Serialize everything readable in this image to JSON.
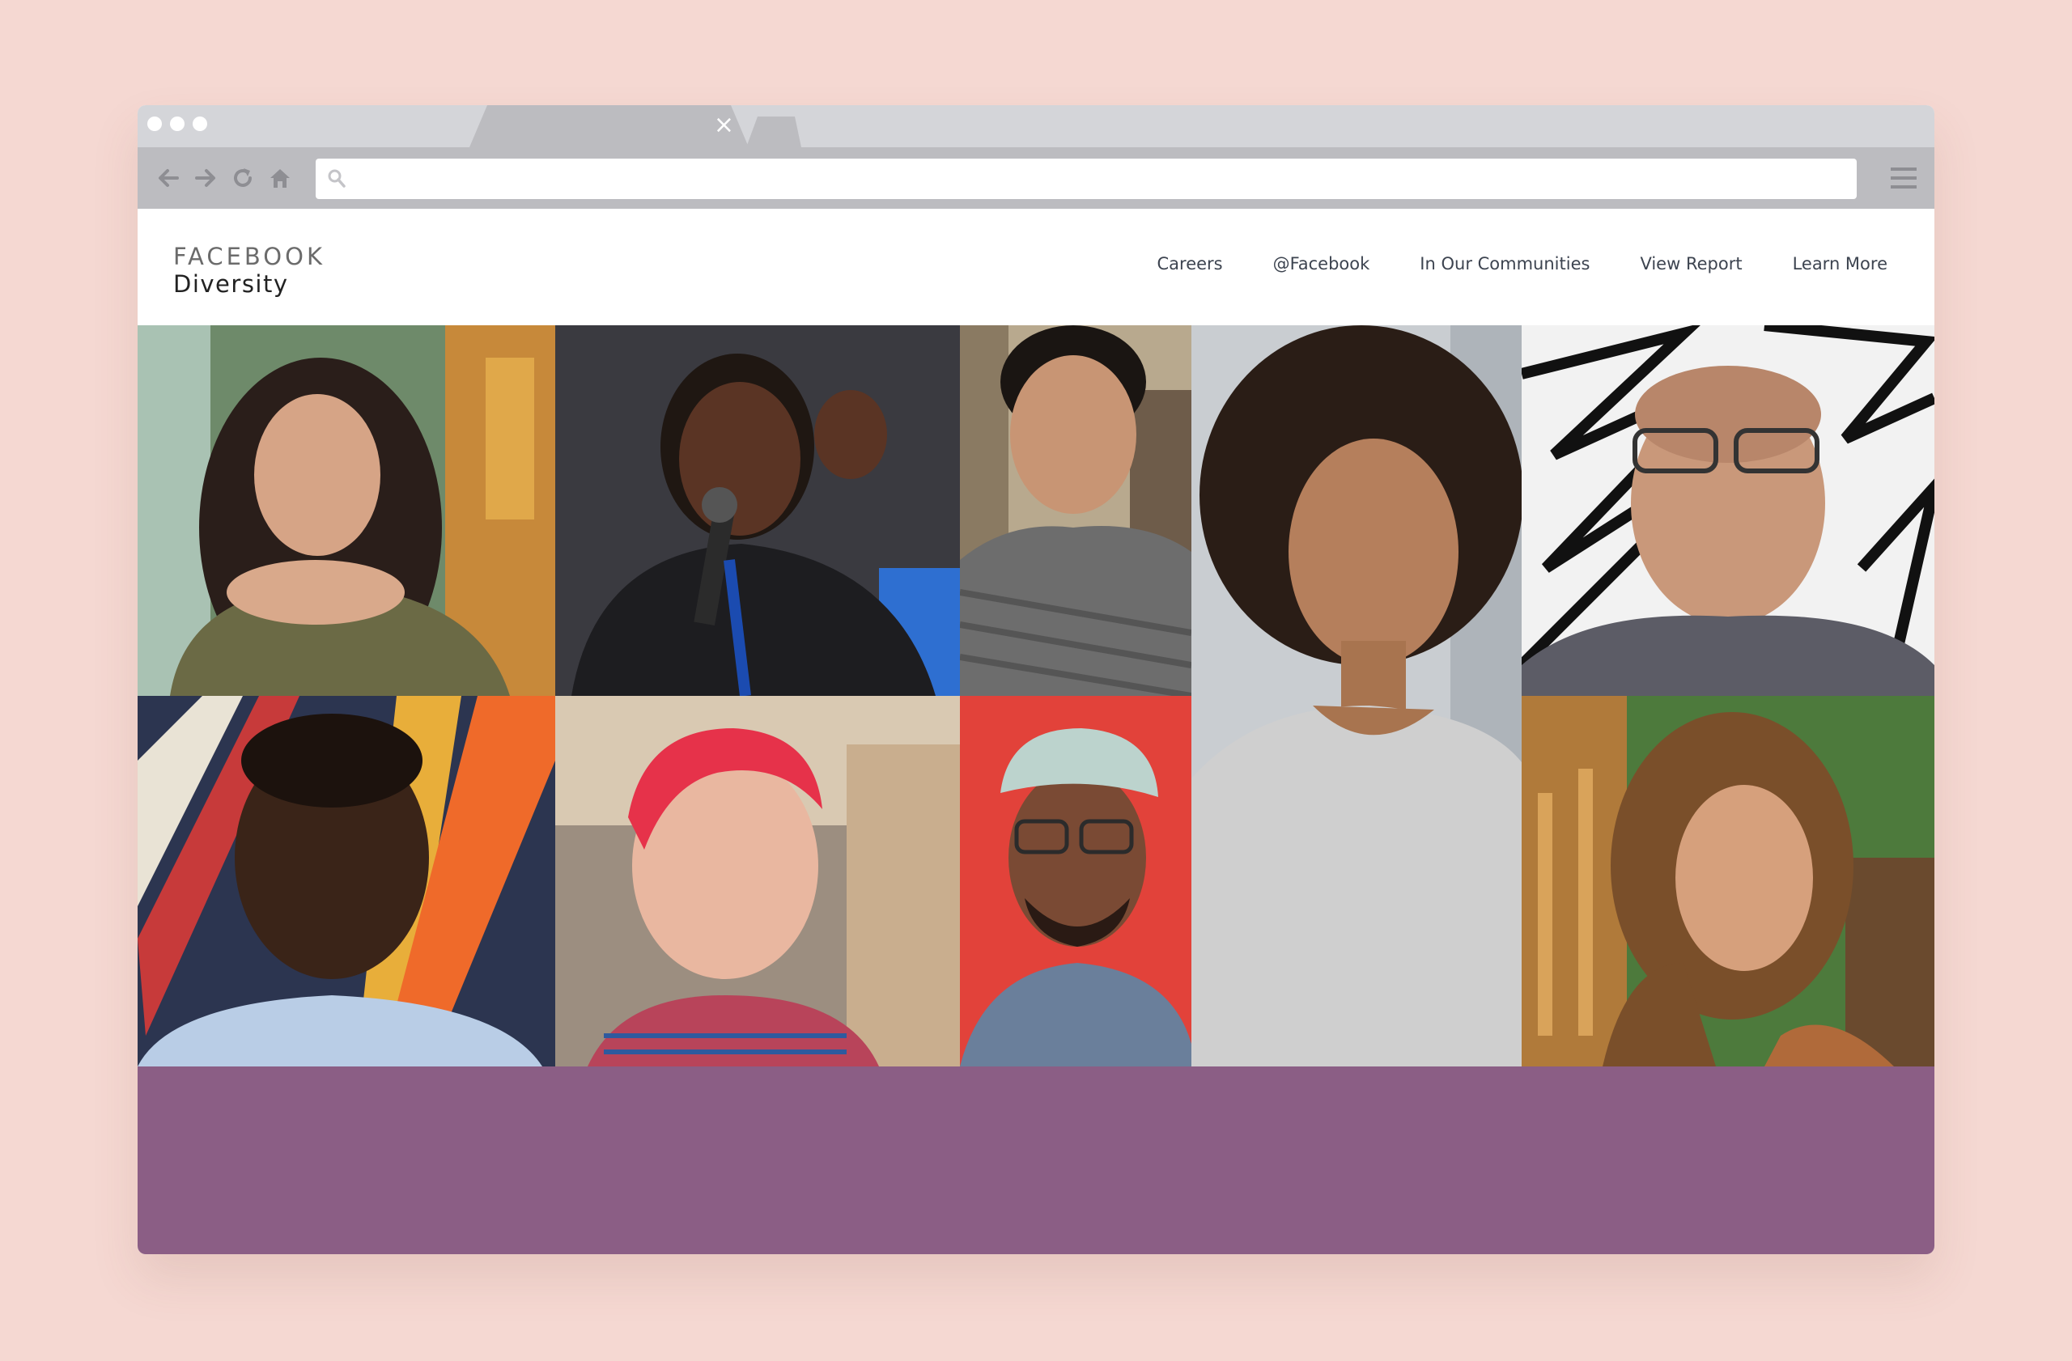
{
  "browser": {
    "tab": {
      "close_glyph": "×"
    },
    "toolbar": {
      "back_icon": "arrow-left-icon",
      "forward_icon": "arrow-right-icon",
      "reload_icon": "reload-icon",
      "home_icon": "home-icon",
      "menu_icon": "hamburger-menu-icon"
    },
    "url": {
      "value": "",
      "placeholder": ""
    }
  },
  "site": {
    "logo": {
      "line1": "FACEBOOK",
      "line2": "Diversity"
    },
    "nav": [
      {
        "label": "Careers"
      },
      {
        "label": "@Facebook"
      },
      {
        "label": "In Our Communities"
      },
      {
        "label": "View Report"
      },
      {
        "label": "Learn More"
      }
    ]
  },
  "colors": {
    "page_background": "#f5d8d2",
    "footer_band": "#8b5e85",
    "tab_strip": "#d4d5d9",
    "toolbar": "#bcbcc0"
  },
  "photos": [
    {
      "name": "woman-dark-hair-portrait"
    },
    {
      "name": "speaker-with-microphone"
    },
    {
      "name": "man-grey-shirt-portrait"
    },
    {
      "name": "woman-curly-hair-portrait"
    },
    {
      "name": "man-glasses-portrait"
    },
    {
      "name": "man-blue-shirt-portrait"
    },
    {
      "name": "woman-pink-hair-portrait"
    },
    {
      "name": "man-cap-glasses-portrait"
    },
    {
      "name": "woman-hijab-portrait"
    }
  ]
}
